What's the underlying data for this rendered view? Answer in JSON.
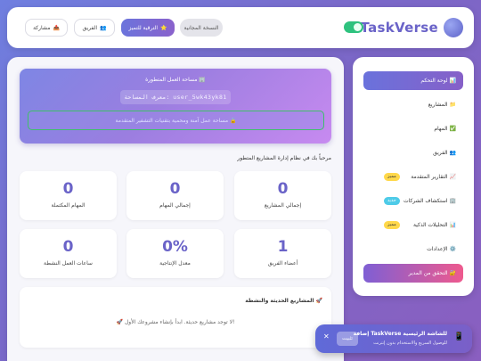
{
  "header": {
    "brand": "TaskVerse",
    "buttons": {
      "free": "النسخة المجانية",
      "upgrade": "الترقية للتميز",
      "upgrade_icon": "⭐",
      "team": "الفريق",
      "team_icon": "👥",
      "share": "مشاركة",
      "share_icon": "📤"
    }
  },
  "workspace": {
    "title": "مساحة العمل المتطورة",
    "title_icon": "🏢",
    "id_line": "معرف المساحة: user_5wk43yk81",
    "secure_text": "مساحة عمل آمنة ومحمية بتقنيات التشفير المتقدمة",
    "secure_icon": "🔒"
  },
  "welcome": "مرحباً بك في نظام إدارة المشاريع المتطور",
  "stats": [
    {
      "value": "0",
      "label": "إجمالي المشاريع"
    },
    {
      "value": "0",
      "label": "إجمالي المهام"
    },
    {
      "value": "0",
      "label": "المهام المكتملة"
    },
    {
      "value": "1",
      "label": "أعضاء الفريق"
    },
    {
      "value": "0%",
      "label": "معدل الإنتاجية"
    },
    {
      "value": "0",
      "label": "ساعات العمل النشطة"
    }
  ],
  "recent": {
    "title": "المشاريع الحديثة والنشطة",
    "title_icon": "🚀",
    "empty": "لا توجد مشاريع حديثة. ابدأ بإنشاء مشروعك الأول!",
    "empty_icon": "🚀"
  },
  "sidebar": {
    "items": [
      {
        "label": "لوحة التحكم",
        "icon": "📊",
        "active": true
      },
      {
        "label": "المشاريع",
        "icon": "📁"
      },
      {
        "label": "المهام",
        "icon": "✅"
      },
      {
        "label": "الفريق",
        "icon": "👥"
      },
      {
        "label": "التقارير المتقدمة",
        "icon": "📈",
        "badge": "مميز"
      },
      {
        "label": "استكشاف الشركات",
        "icon": "🏢",
        "badge": "جديد"
      },
      {
        "label": "التحليلات الذكية",
        "icon": "📊",
        "badge": "مميز"
      },
      {
        "label": "الإعدادات",
        "icon": "⚙️"
      },
      {
        "label": "التحقق من المدير",
        "icon": "🔐",
        "cta": true
      }
    ]
  },
  "toast": {
    "title": "إضافة TaskVerse للشاشة الرئيسية",
    "subtitle": "للوصول السريع والاستخدام بدون إنترنت",
    "install": "تثبيت",
    "close": "✕",
    "icon": "📱"
  },
  "colors": {
    "accent": "#6a63c8",
    "badge_premium": "#ffd84a",
    "badge_new": "#4ecbe8",
    "secure_border": "#3fbf6a"
  }
}
